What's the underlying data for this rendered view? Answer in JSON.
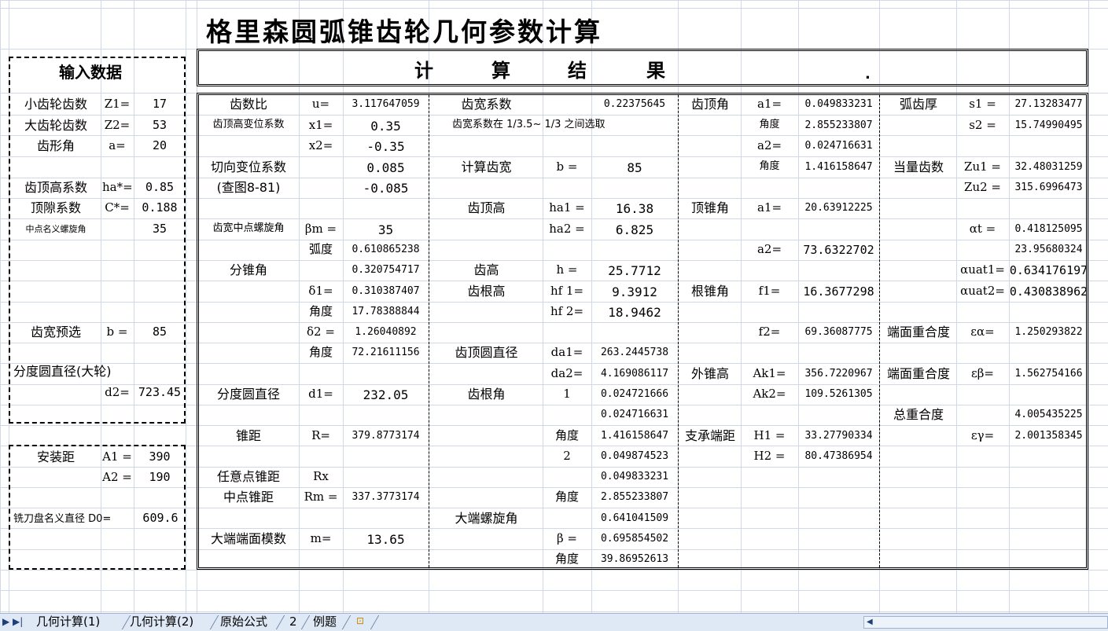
{
  "title": "格里森圆弧锥齿轮几何参数计算",
  "input": {
    "header": "输入数据",
    "rows": [
      {
        "label": "小齿轮齿数",
        "sym": "Z1=",
        "val": "17"
      },
      {
        "label": "大齿轮齿数",
        "sym": "Z2=",
        "val": "53"
      },
      {
        "label": "齿形角",
        "sym": "a=",
        "val": "20"
      },
      {
        "label": "齿顶高系数",
        "sym": "ha*=",
        "val": "0.85"
      },
      {
        "label": "顶隙系数",
        "sym": "C*=",
        "val": "0.188"
      },
      {
        "label": "中点名义螺旋角",
        "sym": "",
        "val": "35"
      }
    ],
    "face_width": {
      "label": "齿宽预选",
      "sym": "b =",
      "val": "85"
    },
    "pitch_dia": {
      "label": "分度圆直径(大轮)",
      "sym": "d2=",
      "val": "723.45"
    },
    "mount": [
      {
        "label": "安装距",
        "sym": "A1 =",
        "val": "390"
      },
      {
        "label": "",
        "sym": "A2 =",
        "val": "190"
      }
    ],
    "cutter": {
      "label": "铣刀盘名义直径 D0=",
      "val": "609.6"
    }
  },
  "result": {
    "header": [
      "计",
      "算",
      "结",
      "果"
    ],
    "dot": ".",
    "col1": [
      {
        "label": "齿数比",
        "sym": "u=",
        "val": "3.117647059"
      },
      {
        "label": "齿顶高变位系数",
        "sym": "x1=",
        "val": "0.35"
      },
      {
        "label": "",
        "sym": "x2=",
        "val": "-0.35"
      },
      {
        "label": "切向变位系数",
        "sym": "",
        "val": "0.085"
      },
      {
        "label": "(查图8-81)",
        "sym": "",
        "val": "-0.085"
      },
      {
        "label": "齿宽中点螺旋角",
        "sym": "βm =",
        "val": "35"
      },
      {
        "label": "",
        "sym": "弧度",
        "val": "0.610865238"
      },
      {
        "label": "分锥角",
        "sym": "",
        "val": "0.320754717"
      },
      {
        "label": "",
        "sym": "δ1=",
        "val": "0.310387407"
      },
      {
        "label": "",
        "sym": "角度",
        "val": "17.78388844"
      },
      {
        "label": "",
        "sym": "δ2 =",
        "val": "1.26040892"
      },
      {
        "label": "",
        "sym": "角度",
        "val": "72.21611156"
      },
      {
        "label": "分度圆直径",
        "sym": "d1=",
        "val": "232.05"
      },
      {
        "label": "锥距",
        "sym": "R=",
        "val": "379.8773174"
      },
      {
        "label": "任意点锥距",
        "sym": "Rx",
        "val": ""
      },
      {
        "label": "中点锥距",
        "sym": "Rm =",
        "val": "337.3773174"
      },
      {
        "label": "大端端面模数",
        "sym": "m=",
        "val": "13.65"
      }
    ],
    "col2": [
      {
        "label": "齿宽系数",
        "sym": "",
        "val": "0.22375645"
      },
      {
        "label": "齿宽系数在 1/3.5~ 1/3 之间选取",
        "sym": "",
        "val": ""
      },
      {
        "label": "计算齿宽",
        "sym": "b =",
        "val": "85"
      },
      {
        "label": "齿顶高",
        "sym": "ha1 =",
        "val": "16.38"
      },
      {
        "label": "",
        "sym": "ha2 =",
        "val": "6.825"
      },
      {
        "label": "齿高",
        "sym": "h =",
        "val": "25.7712"
      },
      {
        "label": "齿根高",
        "sym": "hf 1=",
        "val": "9.3912"
      },
      {
        "label": "",
        "sym": "hf 2=",
        "val": "18.9462"
      },
      {
        "label": "齿顶圆直径",
        "sym": "da1=",
        "val": "263.2445738"
      },
      {
        "label": "",
        "sym": "da2=",
        "val": "4.169086117"
      },
      {
        "label": "齿根角",
        "sym": "1",
        "val": "0.024721666"
      },
      {
        "label": "",
        "sym": "",
        "val": "0.024716631"
      },
      {
        "label": "",
        "sym": "角度",
        "val": "1.416158647"
      },
      {
        "label": "",
        "sym": "2",
        "val": "0.049874523"
      },
      {
        "label": "",
        "sym": "",
        "val": "0.049833231"
      },
      {
        "label": "",
        "sym": "角度",
        "val": "2.855233807"
      },
      {
        "label": "大端螺旋角",
        "sym": "",
        "val": "0.641041509"
      },
      {
        "label": "",
        "sym": "β =",
        "val": "0.695854502"
      },
      {
        "label": "",
        "sym": "角度",
        "val": "39.86952613"
      }
    ],
    "col3": [
      {
        "label": "齿顶角",
        "sym": "a1=",
        "val": "0.049833231"
      },
      {
        "label": "",
        "sym": "角度",
        "val": "2.855233807"
      },
      {
        "label": "",
        "sym": "a2=",
        "val": "0.024716631"
      },
      {
        "label": "",
        "sym": "角度",
        "val": "1.416158647"
      },
      {
        "label": "顶锥角",
        "sym": "a1=",
        "val": "20.63912225"
      },
      {
        "label": "",
        "sym": "a2=",
        "val": "73.6322702"
      },
      {
        "label": "根锥角",
        "sym": "f1=",
        "val": "16.3677298"
      },
      {
        "label": "",
        "sym": "f2=",
        "val": "69.36087775"
      },
      {
        "label": "外锥高",
        "sym": "Ak1=",
        "val": "356.7220967"
      },
      {
        "label": "",
        "sym": "Ak2=",
        "val": "109.5261305"
      },
      {
        "label": "支承端距",
        "sym": "H1 =",
        "val": "33.27790334"
      },
      {
        "label": "",
        "sym": "H2 =",
        "val": "80.47386954"
      }
    ],
    "col4": [
      {
        "label": "弧齿厚",
        "sym": "s1 =",
        "val": "27.13283477"
      },
      {
        "label": "",
        "sym": "s2 =",
        "val": "15.74990495"
      },
      {
        "label": "当量齿数",
        "sym": "Zu1 =",
        "val": "32.48031259"
      },
      {
        "label": "",
        "sym": "Zu2 =",
        "val": "315.6996473"
      },
      {
        "label": "",
        "sym": "αt =",
        "val": "0.418125095"
      },
      {
        "label": "",
        "sym": "",
        "val": "23.95680324"
      },
      {
        "label": "",
        "sym": "αuat1=",
        "val": "0.634176197"
      },
      {
        "label": "",
        "sym": "αuat2=",
        "val": "0.430838962"
      },
      {
        "label": "端面重合度",
        "sym": "εα=",
        "val": "1.250293822"
      },
      {
        "label": "端面重合度",
        "sym": "εβ=",
        "val": "1.562754166"
      },
      {
        "label": "总重合度",
        "sym": "",
        "val": "4.005435225"
      },
      {
        "label": "",
        "sym": "εγ=",
        "val": "2.001358345"
      }
    ]
  },
  "tabs": [
    "几何计算(1)",
    "几何计算(2)",
    "原始公式",
    "2",
    "例题"
  ]
}
